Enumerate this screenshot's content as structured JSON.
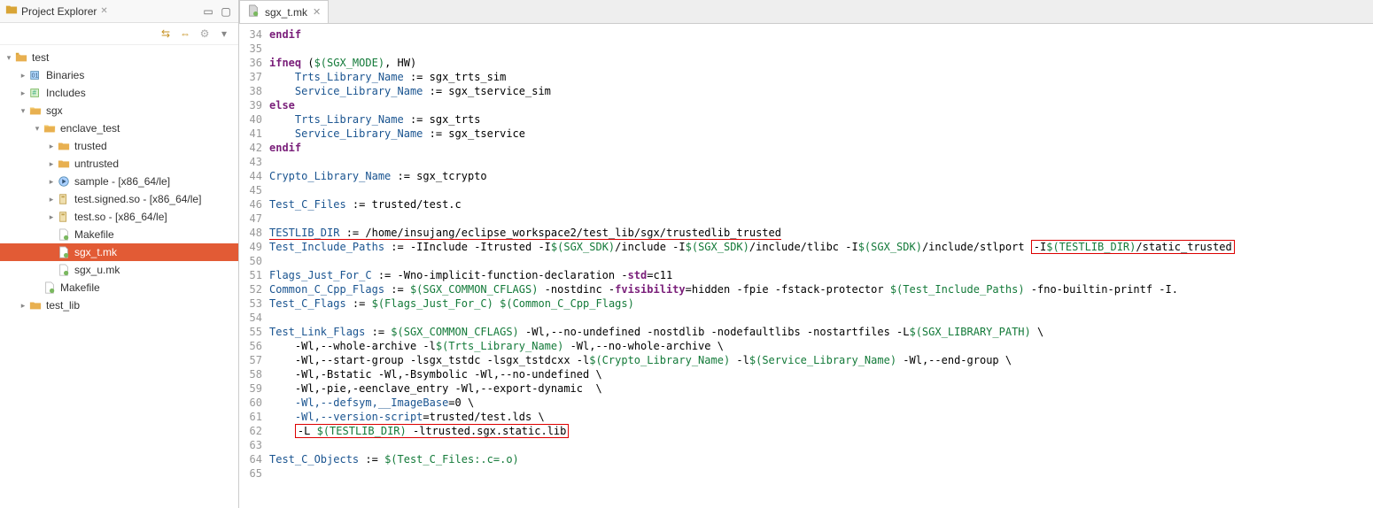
{
  "sidebar": {
    "title": "Project Explorer",
    "tree": [
      {
        "indent": 0,
        "arrow": "▾",
        "icon": "folder-project",
        "label": "test"
      },
      {
        "indent": 1,
        "arrow": "▸",
        "icon": "binaries",
        "label": "Binaries"
      },
      {
        "indent": 1,
        "arrow": "▸",
        "icon": "includes",
        "label": "Includes"
      },
      {
        "indent": 1,
        "arrow": "▾",
        "icon": "folder-open",
        "label": "sgx"
      },
      {
        "indent": 2,
        "arrow": "▾",
        "icon": "folder-open",
        "label": "enclave_test"
      },
      {
        "indent": 3,
        "arrow": "▸",
        "icon": "folder",
        "label": "trusted"
      },
      {
        "indent": 3,
        "arrow": "▸",
        "icon": "folder",
        "label": "untrusted"
      },
      {
        "indent": 3,
        "arrow": "▸",
        "icon": "exec",
        "label": "sample - [x86_64/le]"
      },
      {
        "indent": 3,
        "arrow": "▸",
        "icon": "lib",
        "label": "test.signed.so - [x86_64/le]"
      },
      {
        "indent": 3,
        "arrow": "▸",
        "icon": "lib",
        "label": "test.so - [x86_64/le]"
      },
      {
        "indent": 3,
        "arrow": "",
        "icon": "file",
        "label": "Makefile"
      },
      {
        "indent": 3,
        "arrow": "",
        "icon": "file",
        "label": "sgx_t.mk",
        "selected": true
      },
      {
        "indent": 3,
        "arrow": "",
        "icon": "file",
        "label": "sgx_u.mk"
      },
      {
        "indent": 2,
        "arrow": "",
        "icon": "file",
        "label": "Makefile"
      },
      {
        "indent": 1,
        "arrow": "▸",
        "icon": "folder",
        "label": "test_lib"
      }
    ]
  },
  "editor": {
    "tab_label": "sgx_t.mk",
    "lines": [
      {
        "n": 34,
        "tokens": [
          {
            "t": "kw",
            "v": "endif"
          }
        ]
      },
      {
        "n": 35,
        "tokens": []
      },
      {
        "n": 36,
        "tokens": [
          {
            "t": "kw",
            "v": "ifneq"
          },
          {
            "t": "txt",
            "v": " ("
          },
          {
            "t": "macro",
            "v": "$(SGX_MODE)"
          },
          {
            "t": "txt",
            "v": ", HW)"
          }
        ]
      },
      {
        "n": 37,
        "tokens": [
          {
            "t": "txt",
            "v": "    "
          },
          {
            "t": "var",
            "v": "Trts_Library_Name"
          },
          {
            "t": "txt",
            "v": " := sgx_trts_sim"
          }
        ]
      },
      {
        "n": 38,
        "tokens": [
          {
            "t": "txt",
            "v": "    "
          },
          {
            "t": "var",
            "v": "Service_Library_Name"
          },
          {
            "t": "txt",
            "v": " := sgx_tservice_sim"
          }
        ]
      },
      {
        "n": 39,
        "tokens": [
          {
            "t": "kw",
            "v": "else"
          }
        ]
      },
      {
        "n": 40,
        "tokens": [
          {
            "t": "txt",
            "v": "    "
          },
          {
            "t": "var",
            "v": "Trts_Library_Name"
          },
          {
            "t": "txt",
            "v": " := sgx_trts"
          }
        ]
      },
      {
        "n": 41,
        "tokens": [
          {
            "t": "txt",
            "v": "    "
          },
          {
            "t": "var",
            "v": "Service_Library_Name"
          },
          {
            "t": "txt",
            "v": " := sgx_tservice"
          }
        ]
      },
      {
        "n": 42,
        "tokens": [
          {
            "t": "kw",
            "v": "endif"
          }
        ]
      },
      {
        "n": 43,
        "tokens": []
      },
      {
        "n": 44,
        "tokens": [
          {
            "t": "var",
            "v": "Crypto_Library_Name"
          },
          {
            "t": "txt",
            "v": " := sgx_tcrypto"
          }
        ]
      },
      {
        "n": 45,
        "tokens": []
      },
      {
        "n": 46,
        "tokens": [
          {
            "t": "var",
            "v": "Test_C_Files"
          },
          {
            "t": "txt",
            "v": " := trusted/test.c"
          }
        ]
      },
      {
        "n": 47,
        "tokens": []
      },
      {
        "n": 48,
        "tokens": [
          {
            "t": "var",
            "v": "TESTLIB_DIR",
            "cls": "underline-red"
          },
          {
            "t": "txt",
            "v": " := /home/insujang/eclipse_workspace2/test_lib/sgx/trustedlib_trusted",
            "cls": "underline-red"
          }
        ]
      },
      {
        "n": 49,
        "tokens": [
          {
            "t": "var",
            "v": "Test_Include_Paths"
          },
          {
            "t": "txt",
            "v": " := -IInclude -Itrusted -I"
          },
          {
            "t": "macro",
            "v": "$(SGX_SDK)"
          },
          {
            "t": "txt",
            "v": "/include -I"
          },
          {
            "t": "macro",
            "v": "$(SGX_SDK)"
          },
          {
            "t": "txt",
            "v": "/include/tlibc -I"
          },
          {
            "t": "macro",
            "v": "$(SGX_SDK)"
          },
          {
            "t": "txt",
            "v": "/include/stlport "
          },
          {
            "t": "box",
            "inner": [
              {
                "t": "txt",
                "v": "-I"
              },
              {
                "t": "macro",
                "v": "$(TESTLIB_DIR)"
              },
              {
                "t": "txt",
                "v": "/static_trusted"
              }
            ]
          }
        ]
      },
      {
        "n": 50,
        "tokens": []
      },
      {
        "n": 51,
        "tokens": [
          {
            "t": "var",
            "v": "Flags_Just_For_C"
          },
          {
            "t": "txt",
            "v": " := -Wno-implicit-function-declaration -"
          },
          {
            "t": "kw",
            "v": "std"
          },
          {
            "t": "txt",
            "v": "=c11"
          }
        ]
      },
      {
        "n": 52,
        "tokens": [
          {
            "t": "var",
            "v": "Common_C_Cpp_Flags"
          },
          {
            "t": "txt",
            "v": " := "
          },
          {
            "t": "macro",
            "v": "$(SGX_COMMON_CFLAGS)"
          },
          {
            "t": "txt",
            "v": " -nostdinc -"
          },
          {
            "t": "kw",
            "v": "fvisibility"
          },
          {
            "t": "txt",
            "v": "=hidden -fpie -fstack-protector "
          },
          {
            "t": "macro",
            "v": "$(Test_Include_Paths)"
          },
          {
            "t": "txt",
            "v": " -fno-builtin-printf -I."
          }
        ]
      },
      {
        "n": 53,
        "tokens": [
          {
            "t": "var",
            "v": "Test_C_Flags"
          },
          {
            "t": "txt",
            "v": " := "
          },
          {
            "t": "macro",
            "v": "$(Flags_Just_For_C)"
          },
          {
            "t": "txt",
            "v": " "
          },
          {
            "t": "macro",
            "v": "$(Common_C_Cpp_Flags)"
          }
        ]
      },
      {
        "n": 54,
        "tokens": []
      },
      {
        "n": 55,
        "tokens": [
          {
            "t": "var",
            "v": "Test_Link_Flags"
          },
          {
            "t": "txt",
            "v": " := "
          },
          {
            "t": "macro",
            "v": "$(SGX_COMMON_CFLAGS)"
          },
          {
            "t": "txt",
            "v": " -Wl,--no-undefined -nostdlib -nodefaultlibs -nostartfiles -L"
          },
          {
            "t": "macro",
            "v": "$(SGX_LIBRARY_PATH)"
          },
          {
            "t": "txt",
            "v": " \\"
          }
        ]
      },
      {
        "n": 56,
        "tokens": [
          {
            "t": "txt",
            "v": "    -Wl,--whole-archive -l"
          },
          {
            "t": "macro",
            "v": "$(Trts_Library_Name)"
          },
          {
            "t": "txt",
            "v": " -Wl,--no-whole-archive \\"
          }
        ]
      },
      {
        "n": 57,
        "tokens": [
          {
            "t": "txt",
            "v": "    -Wl,--start-group -lsgx_tstdc -lsgx_tstdcxx -l"
          },
          {
            "t": "macro",
            "v": "$(Crypto_Library_Name)"
          },
          {
            "t": "txt",
            "v": " -l"
          },
          {
            "t": "macro",
            "v": "$(Service_Library_Name)"
          },
          {
            "t": "txt",
            "v": " -Wl,--end-group \\"
          }
        ]
      },
      {
        "n": 58,
        "tokens": [
          {
            "t": "txt",
            "v": "    -Wl,-Bstatic -Wl,-Bsymbolic -Wl,--no-undefined \\"
          }
        ]
      },
      {
        "n": 59,
        "tokens": [
          {
            "t": "txt",
            "v": "    -Wl,-pie,-eenclave_entry -Wl,--export-dynamic  \\"
          }
        ]
      },
      {
        "n": 60,
        "tokens": [
          {
            "t": "txt",
            "v": "    "
          },
          {
            "t": "var",
            "v": "-Wl,--defsym,__ImageBase"
          },
          {
            "t": "txt",
            "v": "=0 \\"
          }
        ]
      },
      {
        "n": 61,
        "tokens": [
          {
            "t": "txt",
            "v": "    "
          },
          {
            "t": "var",
            "v": "-Wl,--version-script"
          },
          {
            "t": "txt",
            "v": "=trusted/test.lds \\"
          }
        ]
      },
      {
        "n": 62,
        "tokens": [
          {
            "t": "txt",
            "v": "    "
          },
          {
            "t": "box",
            "inner": [
              {
                "t": "txt",
                "v": "-L "
              },
              {
                "t": "macro",
                "v": "$(TESTLIB_DIR)"
              },
              {
                "t": "txt",
                "v": " -ltrusted.sgx.static.lib"
              }
            ]
          }
        ]
      },
      {
        "n": 63,
        "tokens": []
      },
      {
        "n": 64,
        "tokens": [
          {
            "t": "var",
            "v": "Test_C_Objects"
          },
          {
            "t": "txt",
            "v": " := "
          },
          {
            "t": "macro",
            "v": "$(Test_C_Files:.c=.o)"
          }
        ]
      },
      {
        "n": 65,
        "tokens": []
      }
    ]
  }
}
